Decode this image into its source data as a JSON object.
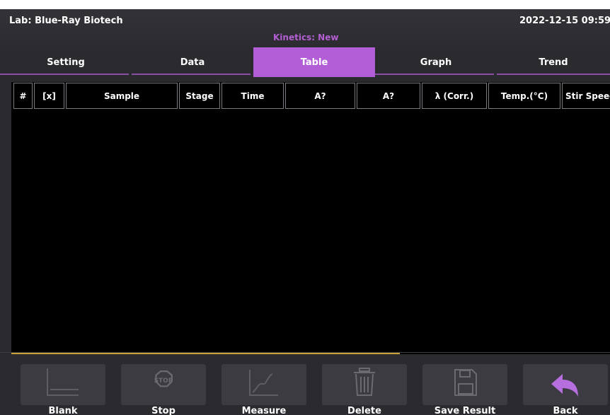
{
  "header": {
    "lab": "Lab: Blue-Ray Biotech",
    "datetime": "2022-12-15 09:59",
    "mode": "Kinetics: New"
  },
  "tabs": [
    {
      "label": "Setting",
      "active": false
    },
    {
      "label": "Data",
      "active": false
    },
    {
      "label": "Table",
      "active": true
    },
    {
      "label": "Graph",
      "active": false
    },
    {
      "label": "Trend",
      "active": false
    }
  ],
  "table": {
    "columns": [
      "#",
      "[x]",
      "Sample",
      "Stage",
      "Time",
      "A?",
      "A?",
      "λ (Corr.)",
      "Temp.(°C)",
      "Stir Speed"
    ],
    "rows": []
  },
  "toolbar": [
    {
      "label": "Blank",
      "icon": "blank-icon",
      "enabled": false
    },
    {
      "label": "Stop",
      "icon": "stop-icon",
      "enabled": false
    },
    {
      "label": "Measure",
      "icon": "measure-icon",
      "enabled": false
    },
    {
      "label": "Delete",
      "icon": "delete-icon",
      "enabled": false
    },
    {
      "label": "Save Result",
      "icon": "save-icon",
      "enabled": false
    },
    {
      "label": "Back",
      "icon": "back-icon",
      "enabled": true
    }
  ],
  "colors": {
    "accent": "#b25ed6",
    "background": "#2a2a2f",
    "scroll_indicator": "#c8a035",
    "back_icon": "#b76fe0"
  }
}
